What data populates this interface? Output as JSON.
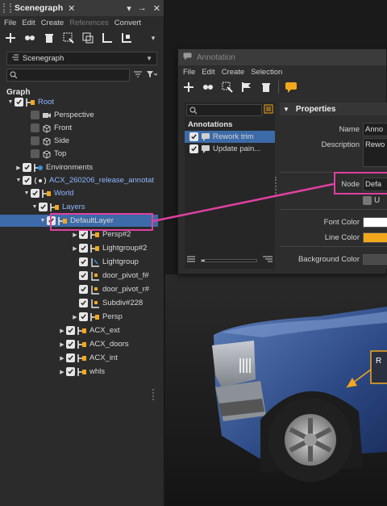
{
  "scenegraph": {
    "title": "Scenegraph",
    "menu": [
      "File",
      "Edit",
      "Create",
      "References",
      "Convert"
    ],
    "view_combo": "Scenegraph",
    "tree_header": "Graph",
    "nodes": [
      {
        "label": "Root",
        "blue": true
      },
      {
        "label": "Perspective"
      },
      {
        "label": "Front"
      },
      {
        "label": "Side"
      },
      {
        "label": "Top"
      },
      {
        "label": "Environments"
      },
      {
        "label": "ACX_260206_release_annotat",
        "blue": true
      },
      {
        "label": "World",
        "blue": true
      },
      {
        "label": "Layers",
        "blue": true
      },
      {
        "label": "DefaultLayer"
      },
      {
        "label": "Persp#2"
      },
      {
        "label": "Lightgroup#2"
      },
      {
        "label": "Lightgroup"
      },
      {
        "label": "door_pivot_f#"
      },
      {
        "label": "door_pivot_r#"
      },
      {
        "label": "Subdiv#228"
      },
      {
        "label": "Persp"
      },
      {
        "label": "ACX_ext"
      },
      {
        "label": "ACX_doors"
      },
      {
        "label": "ACX_int"
      },
      {
        "label": "whls"
      }
    ]
  },
  "annotation": {
    "title": "Annotation",
    "menu": [
      "File",
      "Edit",
      "Create",
      "Selection"
    ],
    "list_header": "Annotations",
    "items": [
      "Rework trim",
      "Update pain..."
    ],
    "properties_header": "Properties",
    "labels": {
      "name": "Name",
      "description": "Description",
      "node": "Node",
      "font_color": "Font Color",
      "line_color": "Line Color",
      "background_color": "Background Color"
    },
    "values": {
      "name": "Anno",
      "description": "Rewo",
      "node": "Defa",
      "checkbox_label": "U"
    },
    "colors": {
      "font": "#ffffff",
      "line": "#f2a81d",
      "background": "#4a4a4a"
    }
  },
  "viewport": {
    "callout_text": "R"
  },
  "highlight_color": "#e040a0",
  "selection_color": "#3d6aa8"
}
